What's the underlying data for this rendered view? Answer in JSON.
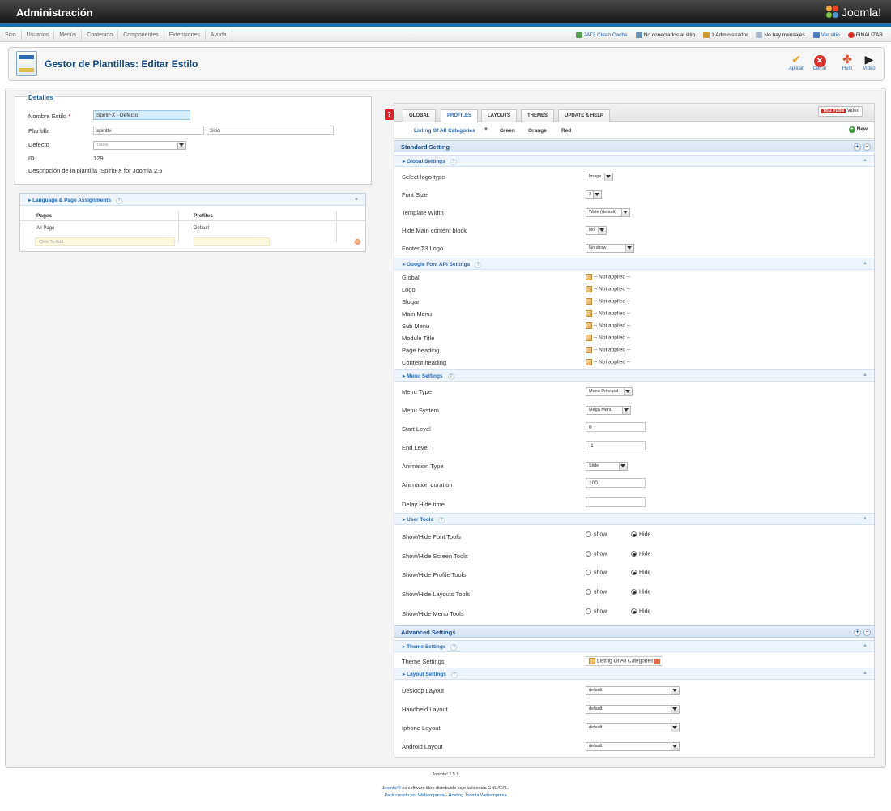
{
  "app": {
    "title": "Administración",
    "brand": "Joomla!"
  },
  "menu": [
    "Sitio",
    "Usuarios",
    "Menús",
    "Contenido",
    "Componentes",
    "Extensiones",
    "Ayuda"
  ],
  "status": {
    "cache": "JAT3 Clean Cache",
    "visitors": "No conectados al sitio",
    "admins": "1 Administrador",
    "messages": "No hay mensajes",
    "view_site": "Ver sitio",
    "logout": "FINALIZAR"
  },
  "page": {
    "title": "Gestor de Plantillas: Editar Estilo"
  },
  "toolbar": {
    "apply": "Aplicar",
    "close": "Cerrar",
    "help": "Help",
    "video": "Video"
  },
  "details": {
    "legend": "Detalles",
    "style_name_label": "Nombre Estilo",
    "required_mark": "*",
    "style_name_value": "SpiritFX - Defecto",
    "template_label": "Plantilla",
    "template_value": "spiritfx",
    "client_value": "Sitio",
    "default_label": "Defecto",
    "default_value": "Todos",
    "id_label": "ID",
    "id_value": "129",
    "description_label": "Descripción de la plantilla",
    "description_value": "SpiritFX for Joomla 2.5"
  },
  "assignments": {
    "title": "Language & Page Assignments",
    "col_pages": "Pages",
    "col_profiles": "Profiles",
    "row_page": "All Page",
    "row_profile": "Default",
    "add_placeholder": "Click To Add"
  },
  "tabs": [
    "GLOBAL",
    "PROFILES",
    "LAYOUTS",
    "THEMES",
    "UPDATE & HELP"
  ],
  "video_button": {
    "yt": "You Tube",
    "label": "Video"
  },
  "profiles": {
    "current": "Listing Of All Categories",
    "items": [
      "Green",
      "Orange",
      "Red"
    ],
    "new": "New"
  },
  "standard": {
    "title": "Standard Setting",
    "global": {
      "title": "Global Settings",
      "rows": [
        {
          "label": "Select logo type",
          "value": "Image"
        },
        {
          "label": "Font Size",
          "value": "3"
        },
        {
          "label": "Template Width",
          "value": "Wide (default)"
        },
        {
          "label": "Hide Main content block",
          "value": "No"
        },
        {
          "label": "Footer T3 Logo",
          "value": "No show"
        }
      ]
    },
    "google": {
      "title": "Google Font API Settings",
      "rows": [
        {
          "label": "Global",
          "value": "-- Not applied --"
        },
        {
          "label": "Logo",
          "value": "-- Not applied --"
        },
        {
          "label": "Slogan",
          "value": "-- Not applied --"
        },
        {
          "label": "Main Menu",
          "value": "-- Not applied --"
        },
        {
          "label": "Sub Menu",
          "value": "-- Not applied --"
        },
        {
          "label": "Module Title",
          "value": "-- Not applied --"
        },
        {
          "label": "Page heading",
          "value": "-- Not applied --"
        },
        {
          "label": "Content heading",
          "value": "-- Not applied --"
        }
      ]
    },
    "menu": {
      "title": "Menu Settings",
      "rows": [
        {
          "label": "Menu Type",
          "value": "Menu Principal"
        },
        {
          "label": "Menu System",
          "value": "Mega Menu"
        },
        {
          "label": "Start Level",
          "value": "0"
        },
        {
          "label": "End Level",
          "value": "-1"
        },
        {
          "label": "Animation Type",
          "value": "Slide"
        },
        {
          "label": "Animation duration",
          "value": "100"
        },
        {
          "label": "Delay Hide time",
          "value": ""
        }
      ]
    },
    "tools": {
      "title": "User Tools",
      "show": "show",
      "hide": "Hide",
      "rows": [
        "Show/Hide Font Tools",
        "Show/Hide Screen Tools",
        "Show/Hide Profile Tools",
        "Show/Hide Layouts Tools",
        "Show/Hide Menu Tools"
      ]
    }
  },
  "advanced": {
    "title": "Advanced Settings",
    "theme": {
      "title": "Theme Settings",
      "label": "Theme Settings",
      "value": "Listing Of All Categories"
    },
    "layout": {
      "title": "Layout Settings",
      "rows": [
        {
          "label": "Desktop Layout",
          "value": "default"
        },
        {
          "label": "Handheld Layout",
          "value": "default"
        },
        {
          "label": "Iphone Layout",
          "value": "default"
        },
        {
          "label": "Android Layout",
          "value": "default"
        }
      ]
    }
  },
  "footer": {
    "version": "Joomla! 2.5.9",
    "license_link": "Joomla!®",
    "license_text": "es software libre distribuido bajo la licencia GNU/GPL.",
    "credits": "Pack creado por Webempresa - Hosting Joomla Webempresa"
  },
  "colors": {
    "accent": "#2769b3",
    "topbar": "#1f1f1f",
    "tab_active": "#2769b3"
  }
}
